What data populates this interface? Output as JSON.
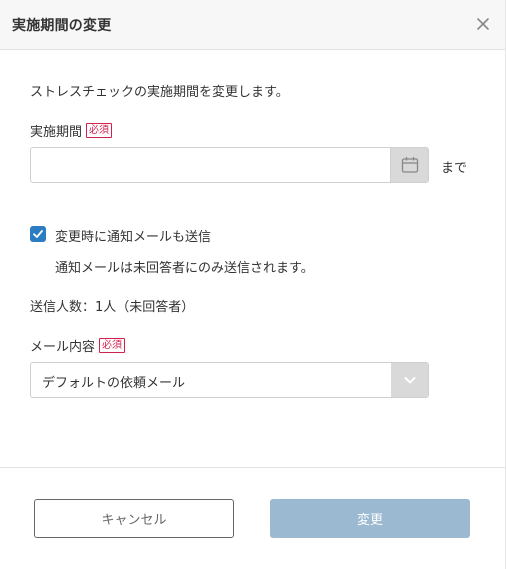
{
  "dialog": {
    "title": "実施期間の変更",
    "description": "ストレスチェックの実施期間を変更します。"
  },
  "period": {
    "label": "実施期間",
    "required_badge": "必須",
    "value": "",
    "suffix": "まで"
  },
  "notify": {
    "checked": true,
    "label": "変更時に通知メールも送信",
    "note": "通知メールは未回答者にのみ送信されます。"
  },
  "recipients": {
    "text": "送信人数：1人（未回答者）"
  },
  "mail": {
    "label": "メール内容",
    "required_badge": "必須",
    "selected": "デフォルトの依頼メール"
  },
  "buttons": {
    "cancel": "キャンセル",
    "submit": "変更"
  },
  "colors": {
    "accent": "#2b7cc1",
    "required": "#d3214c",
    "primary_disabled": "#9bb9d0"
  }
}
